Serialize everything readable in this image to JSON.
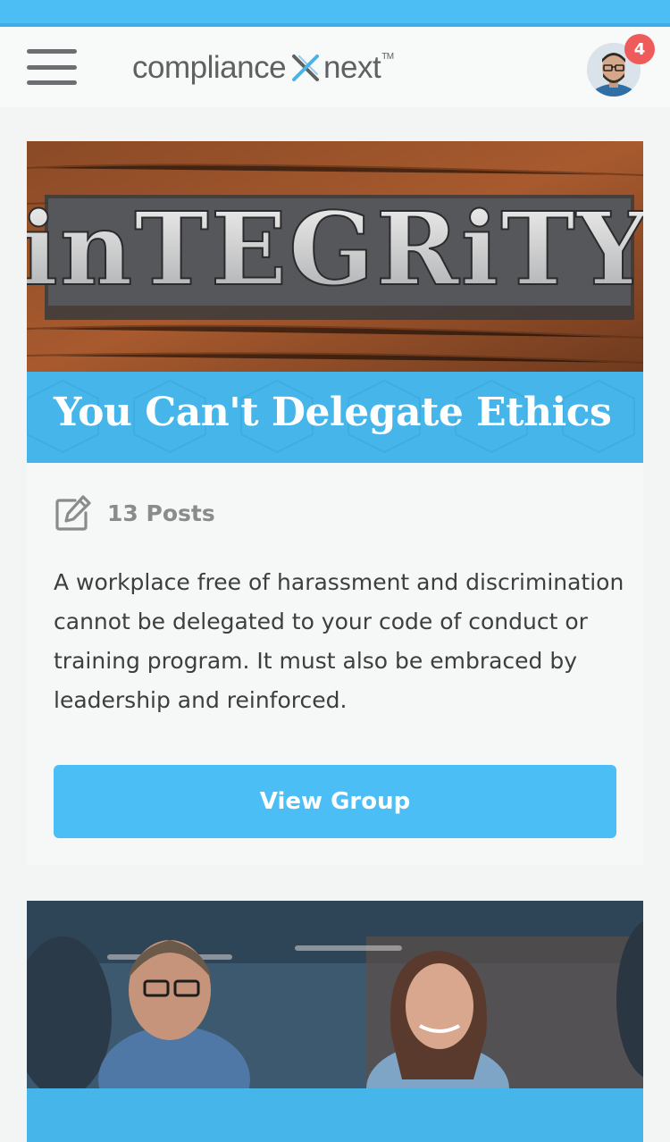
{
  "header": {
    "logo_left": "compliance",
    "logo_right": "next",
    "logo_tm": "TM",
    "notification_count": "4"
  },
  "cards": [
    {
      "hero_word": "inTEGRiTY",
      "title": "You Can't Delegate Ethics",
      "posts_label": "13 Posts",
      "description": "A workplace free of harassment and discrimination cannot be delegated to your code of conduct or training program. It must also be embraced by leadership and reinforced.",
      "button_label": "View Group"
    }
  ],
  "colors": {
    "accent": "#4bbef5",
    "title_band": "#45b5ea",
    "badge": "#ef5b5b"
  },
  "icons": [
    "hamburger-menu-icon",
    "edit-posts-icon",
    "notification-badge"
  ]
}
